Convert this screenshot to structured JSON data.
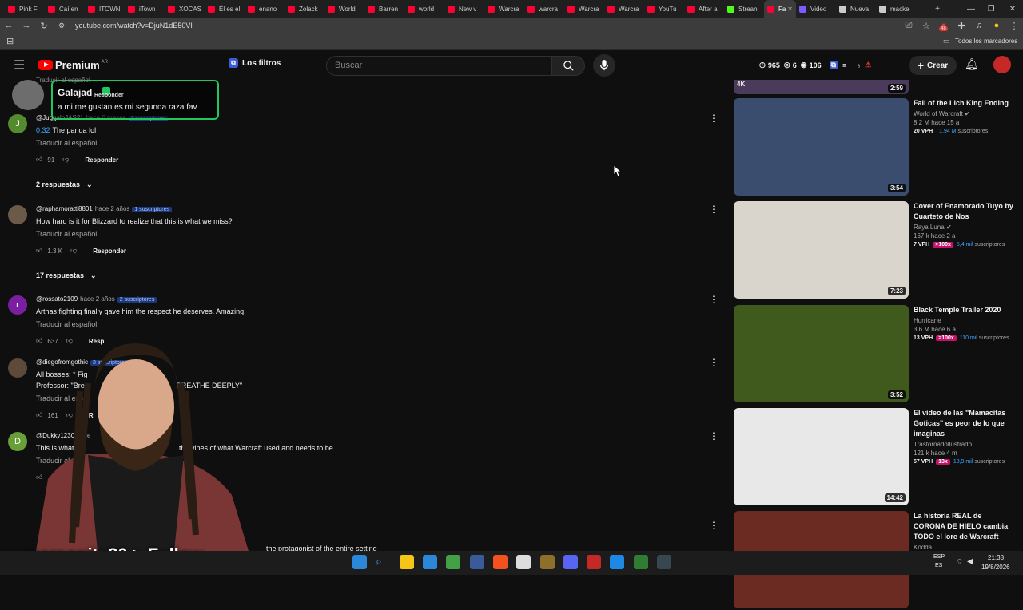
{
  "tabs": [
    {
      "label": "Pink Fl",
      "color": "#ff0033"
    },
    {
      "label": "Caí en",
      "color": "#ff0033"
    },
    {
      "label": "ITOWN",
      "color": "#ff0033"
    },
    {
      "label": "iTown",
      "color": "#ff0033"
    },
    {
      "label": "XOCAS",
      "color": "#ff0033"
    },
    {
      "label": "Él es el",
      "color": "#ff0033"
    },
    {
      "label": "enano",
      "color": "#ff0033"
    },
    {
      "label": "Zolack",
      "color": "#ff0033"
    },
    {
      "label": "World",
      "color": "#ff0033"
    },
    {
      "label": "Barren",
      "color": "#ff0033"
    },
    {
      "label": "world",
      "color": "#ff0033"
    },
    {
      "label": "New v",
      "color": "#ff0033"
    },
    {
      "label": "Warcra",
      "color": "#ff0033"
    },
    {
      "label": "warcra",
      "color": "#ff0033"
    },
    {
      "label": "Warcra",
      "color": "#ff0033"
    },
    {
      "label": "Warcra",
      "color": "#ff0033"
    },
    {
      "label": "YouTu",
      "color": "#ff0033"
    },
    {
      "label": "After a",
      "color": "#ff0033"
    },
    {
      "label": "Strean",
      "color": "#53fc18"
    },
    {
      "label": "Fa",
      "color": "#ff0033",
      "active": true
    },
    {
      "label": "Video",
      "color": "#7c5cff"
    },
    {
      "label": "Nueva",
      "color": "#cccccc"
    },
    {
      "label": "macke",
      "color": "#cccccc"
    }
  ],
  "browser": {
    "url": "youtube.com/watch?v=DjuN1dE50VI",
    "bookmarks_label": "Todos los marcadores",
    "extension_badge": "48"
  },
  "header": {
    "logo": "Premium",
    "region": "AR",
    "filters_label": "Los filtros",
    "search_placeholder": "Buscar",
    "stat_views": "965",
    "stat_likes": "6",
    "stat_watch": "106",
    "create_label": "Crear"
  },
  "overlay_chat": {
    "user": "Galajad",
    "message": "a mi me gustan es mi segunda raza fav",
    "partial_top": "Traducir al español",
    "partial_reply": "Responder"
  },
  "comments": [
    {
      "avatar_letter": "J",
      "avatar_color": "#558b2f",
      "handle": "@JuggaloJAS21",
      "when": "hace 6 meses",
      "subs": "1 suscriptores",
      "timestamp": "0:32",
      "text": "The panda lol",
      "translate": "Traducir al español",
      "likes": "91",
      "reply": "Responder",
      "replies": "2 respuestas"
    },
    {
      "avatar_letter": "",
      "avatar_color": "#6b5a4a",
      "handle": "@raphamoratti8801",
      "when": "hace 2 años",
      "subs": "1 suscriptores",
      "timestamp": "",
      "text": "How hard is it for Blizzard to realize that this is what we miss?",
      "translate": "Traducir al español",
      "likes": "1.3 K",
      "reply": "Responder",
      "replies": "17 respuestas"
    },
    {
      "avatar_letter": "r",
      "avatar_color": "#7b1fa2",
      "handle": "@rossato2109",
      "when": "hace 2 años",
      "subs": "2 suscriptores",
      "timestamp": "",
      "text": "Arthas fighting finally gave him the respect he deserves. Amazing.",
      "translate": "Traducir al español",
      "likes": "637",
      "reply": "Resp",
      "replies": ""
    },
    {
      "avatar_letter": "",
      "avatar_color": "#5d4a3a",
      "handle": "@diegofromgothic",
      "when": "",
      "subs": "3 suscriptores",
      "timestamp": "",
      "text": "All bosses: * Fig",
      "text2": "Professor: \"Brea",
      "text2b": "BREATHE DEEPLY\"",
      "translate": "Traducir al espa",
      "likes": "161",
      "reply": "R",
      "replies": ""
    },
    {
      "avatar_letter": "D",
      "avatar_color": "#689f38",
      "handle": "@Dukky1230",
      "when": "hace",
      "subs": "",
      "timestamp": "",
      "text": "This is what all",
      "text_tail": "the vibes of what Warcraft used and needs to be.",
      "translate": "Traducir al",
      "likes": "",
      "reply": "",
      "replies": ""
    }
  ],
  "last_comment_tail": "the protagonist of the entire setting",
  "related": [
    {
      "title": "Fall of the Lich King Ending",
      "channel": "World of Warcraft",
      "verified": true,
      "stats": "8.2 M  hace 15 a",
      "vph": "20 VPH",
      "mult": "",
      "subs": "1,94 M",
      "duration": "3:54",
      "bg": "#3a4d6e"
    },
    {
      "title": "Cover of Enamorado Tuyo by Cuarteto de Nos",
      "channel": "Raya Luna",
      "verified": true,
      "stats": "167 k  hace 2 a",
      "vph": "7 VPH",
      "mult": ">100x",
      "subs": "5,4 mil",
      "duration": "7:23",
      "bg": "#d9d4cc"
    },
    {
      "title": "Black Temple Trailer 2020",
      "channel": "Hurricane",
      "verified": false,
      "stats": "3.6 M  hace 6 a",
      "vph": "13 VPH",
      "mult": ">100x",
      "subs": "110 mil",
      "duration": "3:52",
      "bg": "#3f5a1c"
    },
    {
      "title": "El video de las \"Mamacitas Goticas\" es peor de lo que imaginas",
      "channel": "Trastornadollustrado",
      "verified": false,
      "stats": "121 k  hace 4 m",
      "vph": "57 VPH",
      "mult": "13x",
      "subs": "13,9 mil",
      "duration": "14:42",
      "bg": "#e8e8e8"
    },
    {
      "title": "La historia REAL de CORONA DE HIELO cambia TODO el lore de Warcraft",
      "channel": "Kodda",
      "verified": false,
      "stats": "",
      "vph": "",
      "mult": "",
      "subs": "",
      "duration": "",
      "bg": "#6b2a22"
    }
  ],
  "top_thumb_duration": "2:59",
  "related_subs_suffix": "suscriptores",
  "stream": {
    "follow_text": "marsopita80 > Follow"
  },
  "taskbar": {
    "lang": "ESP",
    "lang2": "ES",
    "time": "21:38",
    "date": "19/8/2026"
  },
  "colors": {
    "accent_blue": "#3ea6ff",
    "youtube_red": "#ff0000",
    "chat_border": "#22c55e"
  }
}
